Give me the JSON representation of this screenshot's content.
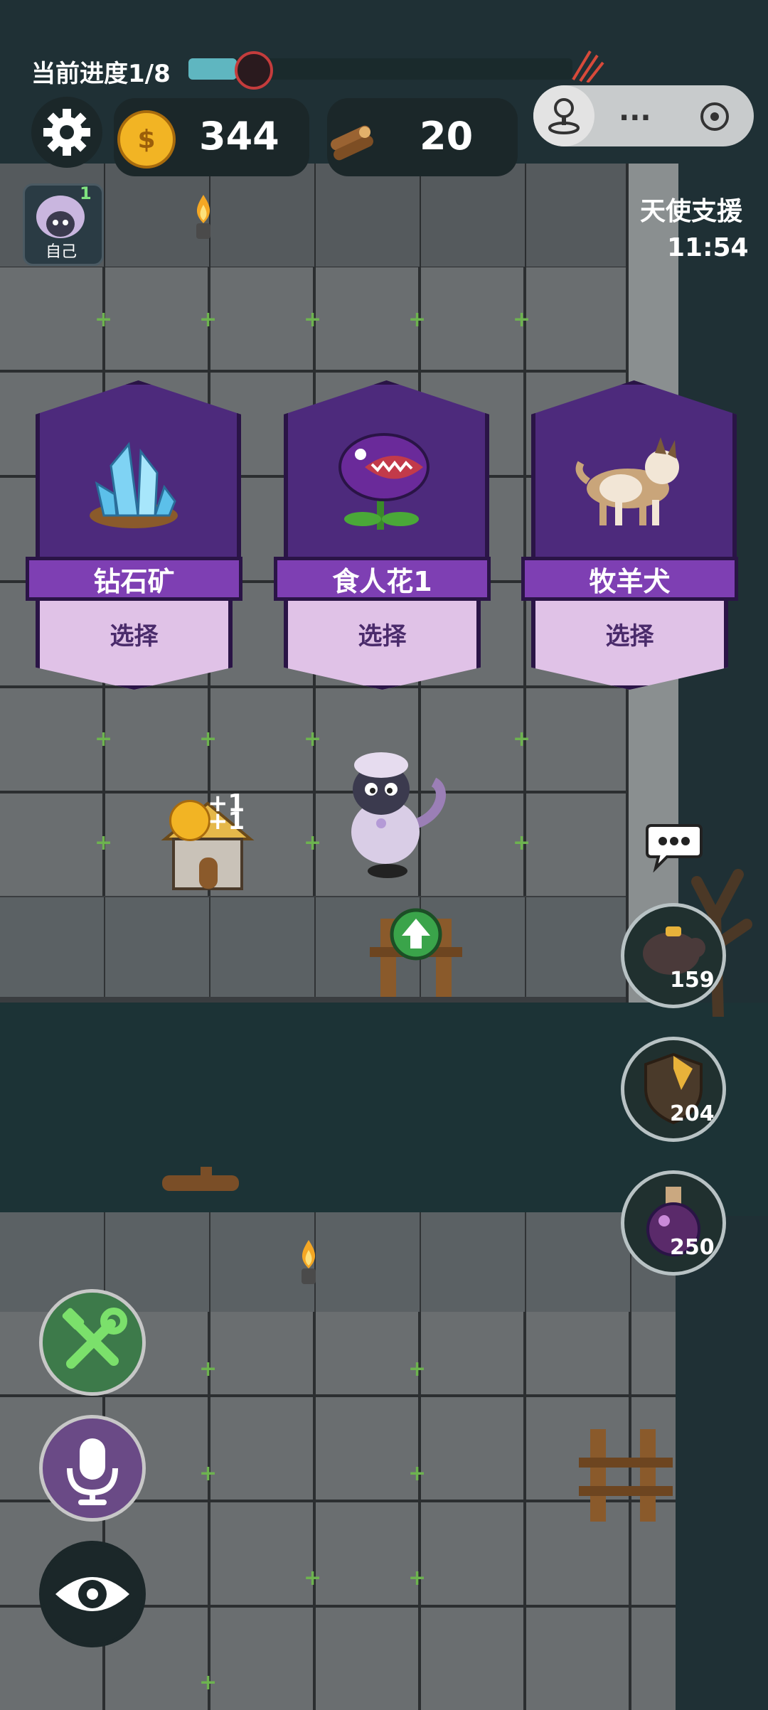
{
  "hud": {
    "progress_label": "当前进度1/8",
    "progress_fraction": 0.125,
    "coins": "344",
    "wood": "20"
  },
  "self": {
    "label": "自己",
    "badge": "1"
  },
  "angel_support": {
    "title": "天使支援",
    "timer": "11:54"
  },
  "cards": [
    {
      "name": "钻石矿",
      "action": "选择",
      "icon": "crystal-icon"
    },
    {
      "name": "食人花1",
      "action": "选择",
      "icon": "piranha-plant-icon"
    },
    {
      "name": "牧羊犬",
      "action": "选择",
      "icon": "sheepdog-icon"
    }
  ],
  "board": {
    "house_bonus_1": "+1",
    "house_bonus_2": "+1"
  },
  "side_buttons": [
    {
      "icon": "piggy-bank-icon",
      "value": "159"
    },
    {
      "icon": "shield-icon",
      "value": "204"
    },
    {
      "icon": "potion-icon",
      "value": "250"
    }
  ],
  "colors": {
    "card_purple": "#4d2a7c",
    "card_ribbon": "#7e3fb3",
    "card_bottom": "#e0c2e7",
    "progress_fill": "#5fb6c0",
    "coin_gold": "#f2b424"
  }
}
